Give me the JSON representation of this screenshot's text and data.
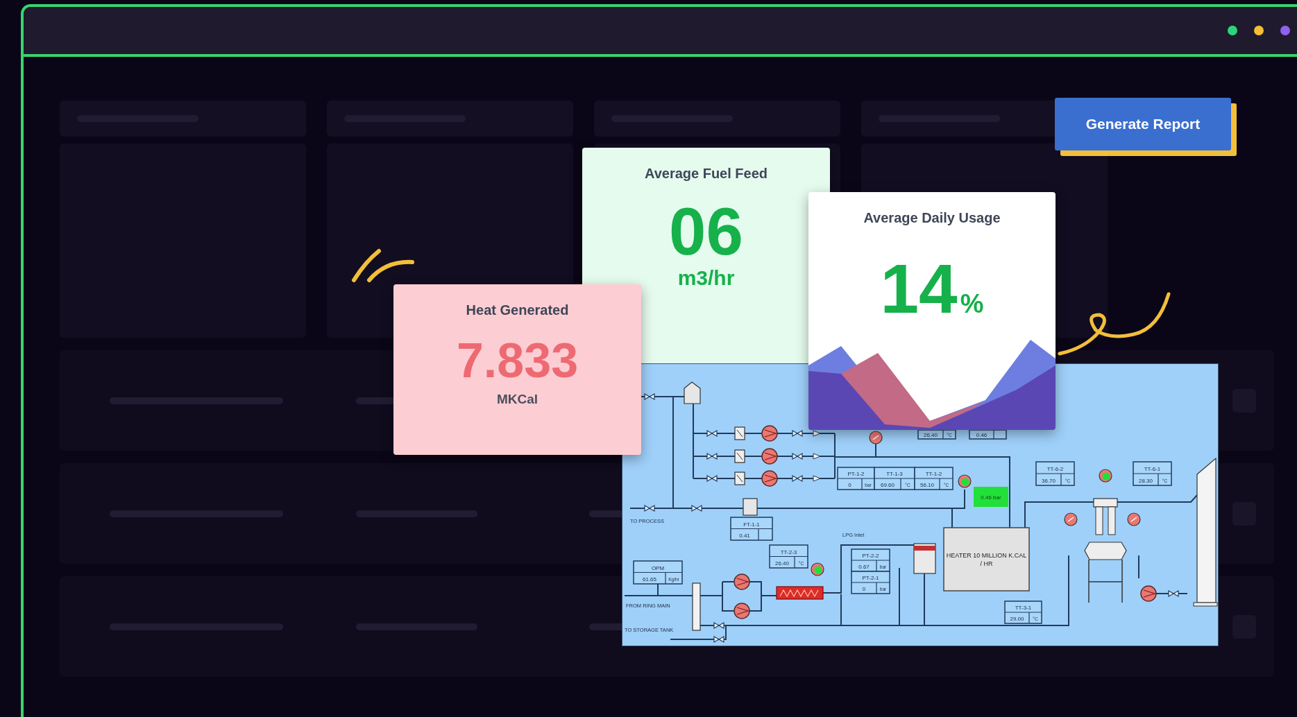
{
  "window_controls": [
    {
      "color": "#2ed47a"
    },
    {
      "color": "#f5be36"
    },
    {
      "color": "#9061f0"
    }
  ],
  "generate_report_button": "Generate Report",
  "stat_cards": [
    {
      "kind": "fuel",
      "title": "Average Fuel Feed",
      "value": "06",
      "unit": "m3/hr"
    },
    {
      "kind": "heat",
      "title": "Heat Generated",
      "value": "7.833",
      "unit": "MKCal"
    },
    {
      "kind": "usage",
      "title": "Average Daily Usage",
      "value": "14",
      "unit": "%"
    }
  ],
  "process_diagram": {
    "labels": [
      "TO PROCESS",
      "FROM RING MAIN",
      "TO STORAGE TANK",
      "LPG Inlet"
    ],
    "heater_label": "HEATER 10 MILLION K.CAL / HR",
    "status_readout": "0.46 bar",
    "readouts": [
      {
        "kind": "full",
        "tag": "FT-1-1",
        "value": "0.41"
      },
      {
        "kind": "full",
        "tag": "OPM",
        "value": "61.65",
        "unit": "Kg/hr"
      },
      {
        "kind": "full",
        "tag": "TT-2-3",
        "value": "26.40",
        "unit": "°C"
      },
      {
        "kind": "full",
        "tag": "PT-1-2",
        "value": "0",
        "unit": "bar"
      },
      {
        "kind": "full",
        "tag": "TT-1-3",
        "value": "69.60",
        "unit": "°C"
      },
      {
        "kind": "full",
        "tag": "TT-1-2",
        "value": "56.10",
        "unit": "°C"
      },
      {
        "kind": "full",
        "tag": "PT-2-2",
        "value": "0.67",
        "unit": "bar"
      },
      {
        "kind": "full",
        "tag": "PT-2-1",
        "value": "0",
        "unit": "bar"
      },
      {
        "kind": "full",
        "tag": "TT-3-1",
        "value": "29.00",
        "unit": "°C"
      },
      {
        "kind": "full",
        "tag": "TT-6-2",
        "value": "36.70",
        "unit": "°C"
      },
      {
        "kind": "full",
        "tag": "TT-6-1",
        "value": "28.30",
        "unit": "°C"
      },
      {
        "kind": "value_only",
        "value": "26.40",
        "unit": "°C"
      },
      {
        "kind": "value_only",
        "value": "0.46"
      }
    ]
  }
}
